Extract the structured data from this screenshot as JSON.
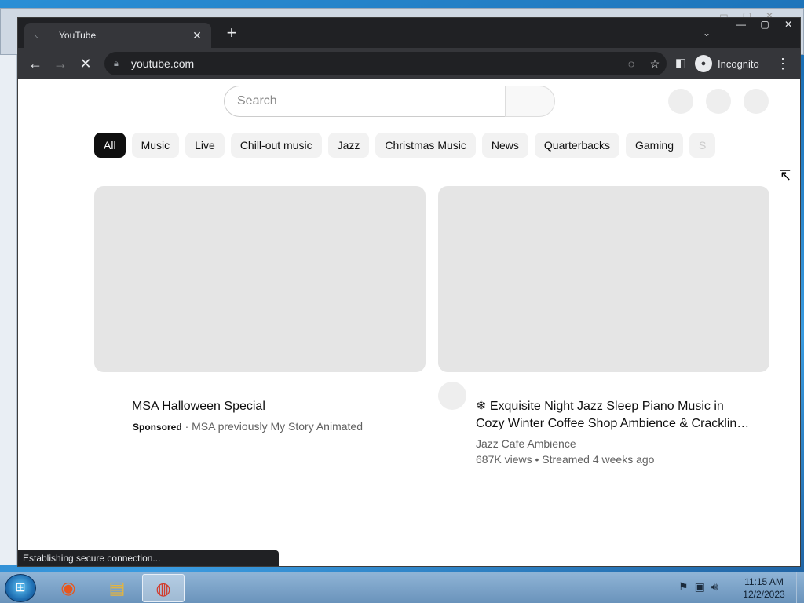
{
  "browser": {
    "tab_title": "YouTube",
    "tab_close": "✕",
    "new_tab": "+",
    "address": "youtube.com",
    "incognito_label": "Incognito",
    "status_text": "Establishing secure connection..."
  },
  "youtube": {
    "search_placeholder": "Search",
    "chips": [
      "All",
      "Music",
      "Live",
      "Chill-out music",
      "Jazz",
      "Christmas Music",
      "News",
      "Quarterbacks",
      "Gaming",
      "S"
    ],
    "videos": [
      {
        "title": "MSA Halloween Special",
        "sponsored": "Sponsored",
        "channel": "· MSA previously My Story Animated"
      },
      {
        "title_line1": "❄︎ Exquisite Night Jazz Sleep Piano Music in",
        "title_line2": "Cozy Winter Coffee Shop Ambience & Cracklin…",
        "channel": "Jazz Cafe Ambience",
        "meta": "687K views • Streamed 4 weeks ago"
      }
    ]
  },
  "taskbar": {
    "time": "11:15 AM",
    "date": "12/2/2023"
  }
}
